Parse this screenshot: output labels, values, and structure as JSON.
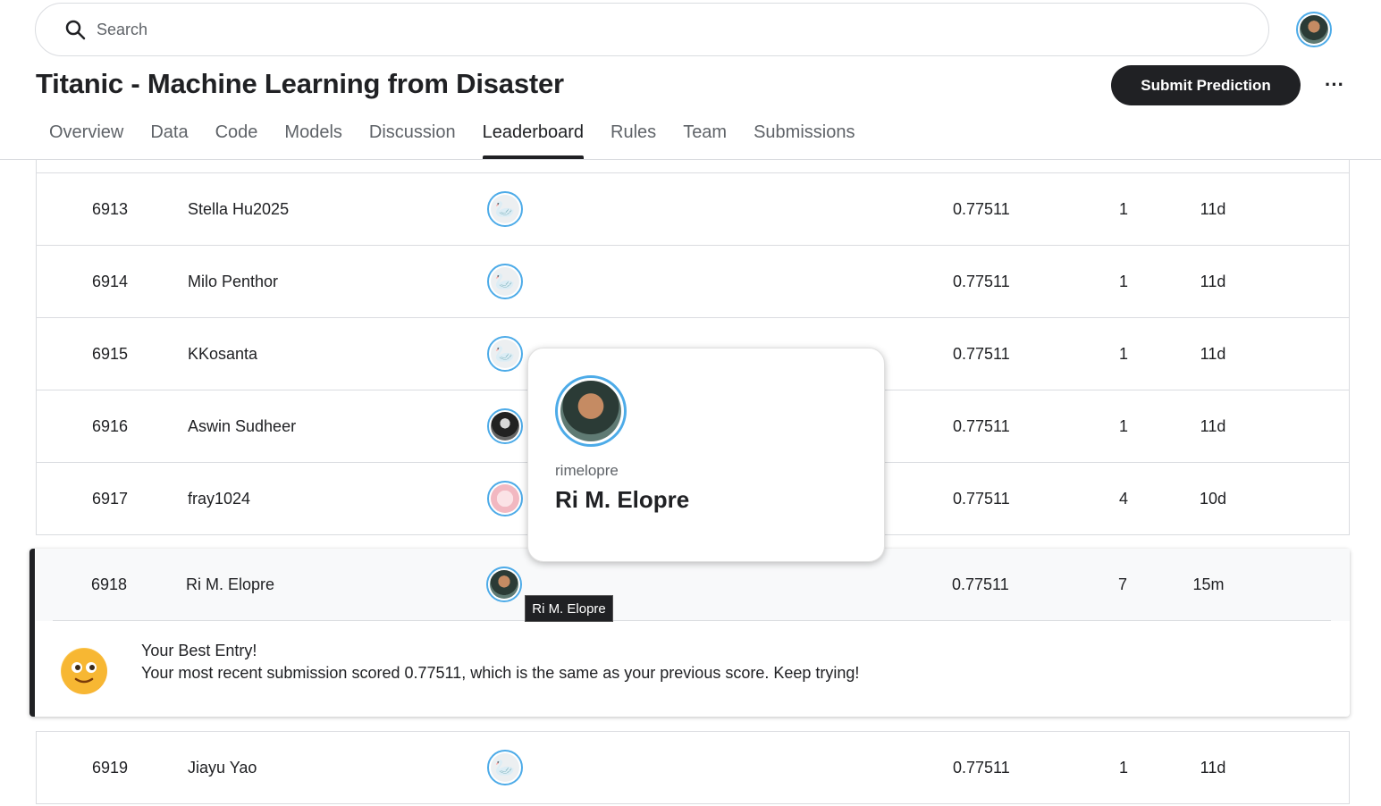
{
  "search": {
    "placeholder": "Search",
    "icon": "search-icon"
  },
  "header": {
    "title": "Titanic - Machine Learning from Disaster",
    "submit_label": "Submit Prediction",
    "more_label": "···"
  },
  "tabs": [
    {
      "label": "Overview"
    },
    {
      "label": "Data"
    },
    {
      "label": "Code"
    },
    {
      "label": "Models"
    },
    {
      "label": "Discussion"
    },
    {
      "label": "Leaderboard",
      "active": true
    },
    {
      "label": "Rules"
    },
    {
      "label": "Team"
    },
    {
      "label": "Submissions"
    }
  ],
  "rows": [
    {
      "rank": "6913",
      "name": "Stella Hu2025",
      "score": "0.77511",
      "entries": "1",
      "last": "11d"
    },
    {
      "rank": "6914",
      "name": "Milo Penthor",
      "score": "0.77511",
      "entries": "1",
      "last": "11d"
    },
    {
      "rank": "6915",
      "name": "KKosanta",
      "score": "0.77511",
      "entries": "1",
      "last": "11d"
    },
    {
      "rank": "6916",
      "name": "Aswin Sudheer",
      "score": "0.77511",
      "entries": "1",
      "last": "11d"
    },
    {
      "rank": "6917",
      "name": "fray1024",
      "score": "0.77511",
      "entries": "4",
      "last": "10d"
    }
  ],
  "my_entry": {
    "rank": "6918",
    "name": "Ri M. Elopre",
    "score": "0.77511",
    "entries": "7",
    "last": "15m",
    "best_title": "Your Best Entry!",
    "best_message": "Your most recent submission scored 0.77511, which is the same as your previous score. Keep trying!"
  },
  "next_row": {
    "rank": "6919",
    "name": "Jiayu Yao",
    "score": "0.77511",
    "entries": "1",
    "last": "11d"
  },
  "popover": {
    "username": "rimelopre",
    "display_name": "Ri M. Elopre"
  },
  "tooltip": {
    "text": "Ri M. Elopre"
  },
  "colors": {
    "accent": "#4dabe8",
    "dark": "#202124",
    "border": "#dadce0"
  }
}
